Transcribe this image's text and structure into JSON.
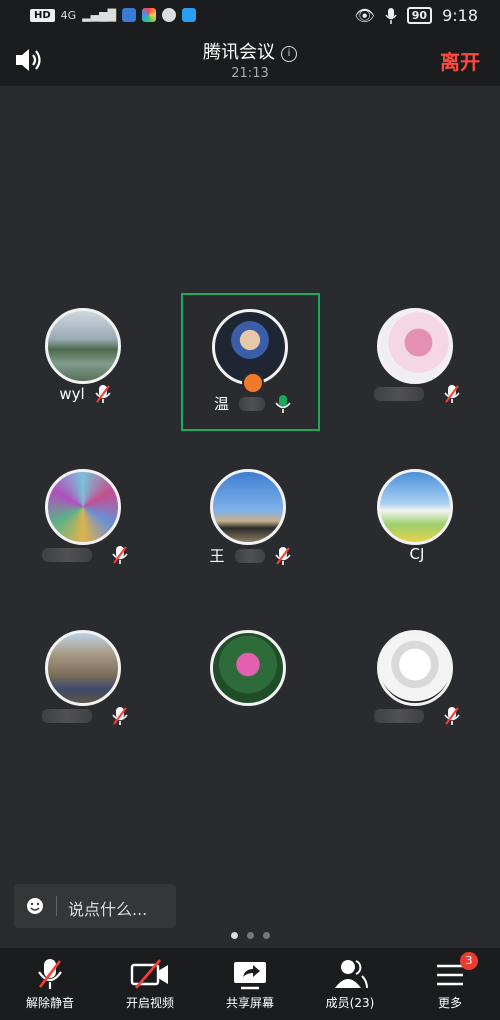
{
  "status_bar": {
    "network": "HD",
    "signal": "4G",
    "battery": "90",
    "time": "9:18"
  },
  "header": {
    "title": "腾讯会议",
    "timer": "21:13",
    "leave_label": "离开"
  },
  "participants": [
    {
      "name": "wyl",
      "muted": true
    },
    {
      "name": "温",
      "muted": false,
      "active": true
    },
    {
      "name": "",
      "muted": true
    },
    {
      "name": "",
      "muted": true
    },
    {
      "name": "王",
      "muted": true
    },
    {
      "name": "CJ",
      "muted": false
    },
    {
      "name": "",
      "muted": true
    },
    {
      "name": "",
      "muted": false
    },
    {
      "name": "",
      "muted": true
    }
  ],
  "chat": {
    "placeholder": "说点什么..."
  },
  "pager": {
    "pages": 3,
    "current": 1
  },
  "toolbar": {
    "unmute_label": "解除静音",
    "video_label": "开启视频",
    "share_label": "共享屏幕",
    "members_label": "成员(23)",
    "more_label": "更多",
    "more_badge": "3"
  },
  "colors": {
    "accent": "#1aab5a",
    "leave": "#ff4a3f",
    "badge": "#ee3b32"
  }
}
